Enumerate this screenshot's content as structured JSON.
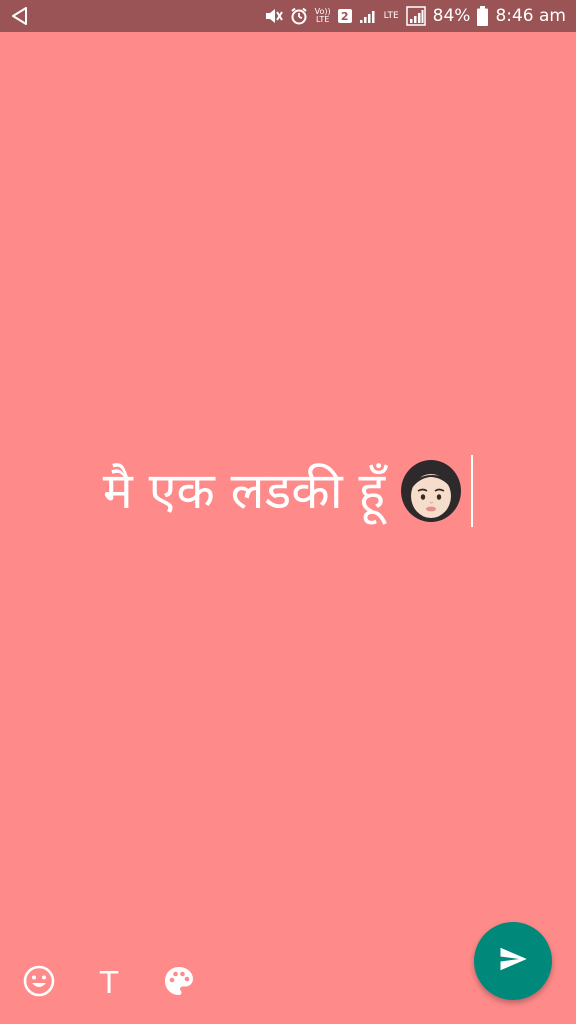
{
  "status_bar": {
    "volte_label_top": "Vo))",
    "volte_label_bottom": "LTE",
    "sim_slot": "2",
    "lte_label": "LTE",
    "battery_percent": "84%",
    "time": "8:46 am",
    "background_color": "#9A5456"
  },
  "story": {
    "text": "मै एक लडकी हूँ",
    "emoji": "woman-face-emoji",
    "background_color": "#FF8A8A",
    "text_color": "#FFFFFF"
  },
  "toolbar": {
    "emoji_icon": "smiley-icon",
    "text_tool_label": "T",
    "palette_icon": "palette-icon"
  },
  "send_button": {
    "icon": "send-icon",
    "color": "#00897B"
  }
}
